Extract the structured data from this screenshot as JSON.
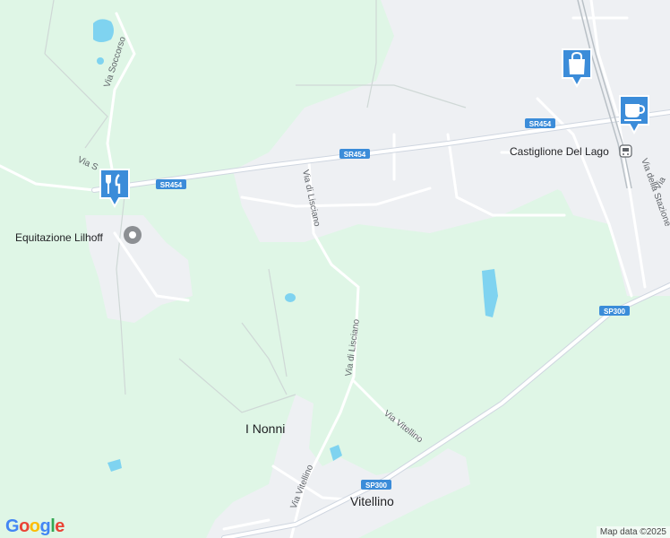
{
  "map": {
    "places": {
      "castiglione": "Castiglione Del Lago",
      "equitazione": "Equitazione Lilhoff",
      "i_nonni": "I Nonni",
      "vitellino": "Vitellino"
    },
    "roads": {
      "sr454_a": "SR454",
      "sr454_b": "SR454",
      "sr454_c": "SR454",
      "sp300_a": "SP300",
      "sp300_b": "SP300",
      "via_lisciano_a": "Via di Lisciano",
      "via_lisciano_b": "Via di Lisciano",
      "via_vitellino_a": "Via Vitellino",
      "via_vitellino_b": "Via Vitellino",
      "via_soccorso": "Via Soccorso",
      "via_s_partial": "Via S",
      "via_stazione": "Via della Stazione",
      "via_partial_right": "Via"
    },
    "pins": [
      {
        "name": "restaurant",
        "icon": "fork-knife-icon"
      },
      {
        "name": "shopping",
        "icon": "shopping-bag-icon"
      },
      {
        "name": "cafe",
        "icon": "coffee-cup-icon"
      }
    ],
    "colors": {
      "land": "#dff6e6",
      "urban": "#eef0f3",
      "water": "#7fd3f0",
      "road_minor": "#ffffff",
      "shield": "#3b8cd9",
      "pin": "#3b8cd9"
    }
  },
  "branding": {
    "logo": "Google",
    "attribution": "Map data ©2025"
  }
}
